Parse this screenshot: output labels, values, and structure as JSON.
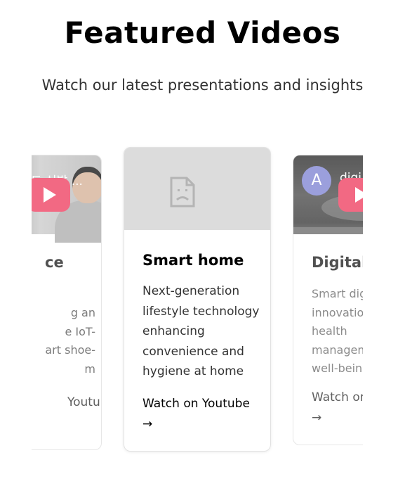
{
  "section": {
    "title": "Featured Videos",
    "subtitle": "Watch our latest presentations and insights"
  },
  "cards": {
    "left": {
      "thumb_caption": "드 신발 ...",
      "title": "ce",
      "description": "g an\ne IoT-\nart shoe-\nm",
      "link": "Youtube"
    },
    "center": {
      "thumb_icon": "broken-image-icon",
      "title": "Smart home",
      "description": "Next-generation lifestyle technology enhancing convenience and hygiene at home",
      "link": "Watch on Youtube →"
    },
    "right": {
      "avatar_letter": "A",
      "thumb_caption": "digi",
      "title": "Digital",
      "description": "Smart dig\ninnovatio\nhealth\nmanagem\nwell-being",
      "link": "Watch on\n→"
    }
  },
  "colors": {
    "play_button": "#f0506e",
    "avatar": "#8a8fd6",
    "placeholder": "#dcdcdc"
  }
}
